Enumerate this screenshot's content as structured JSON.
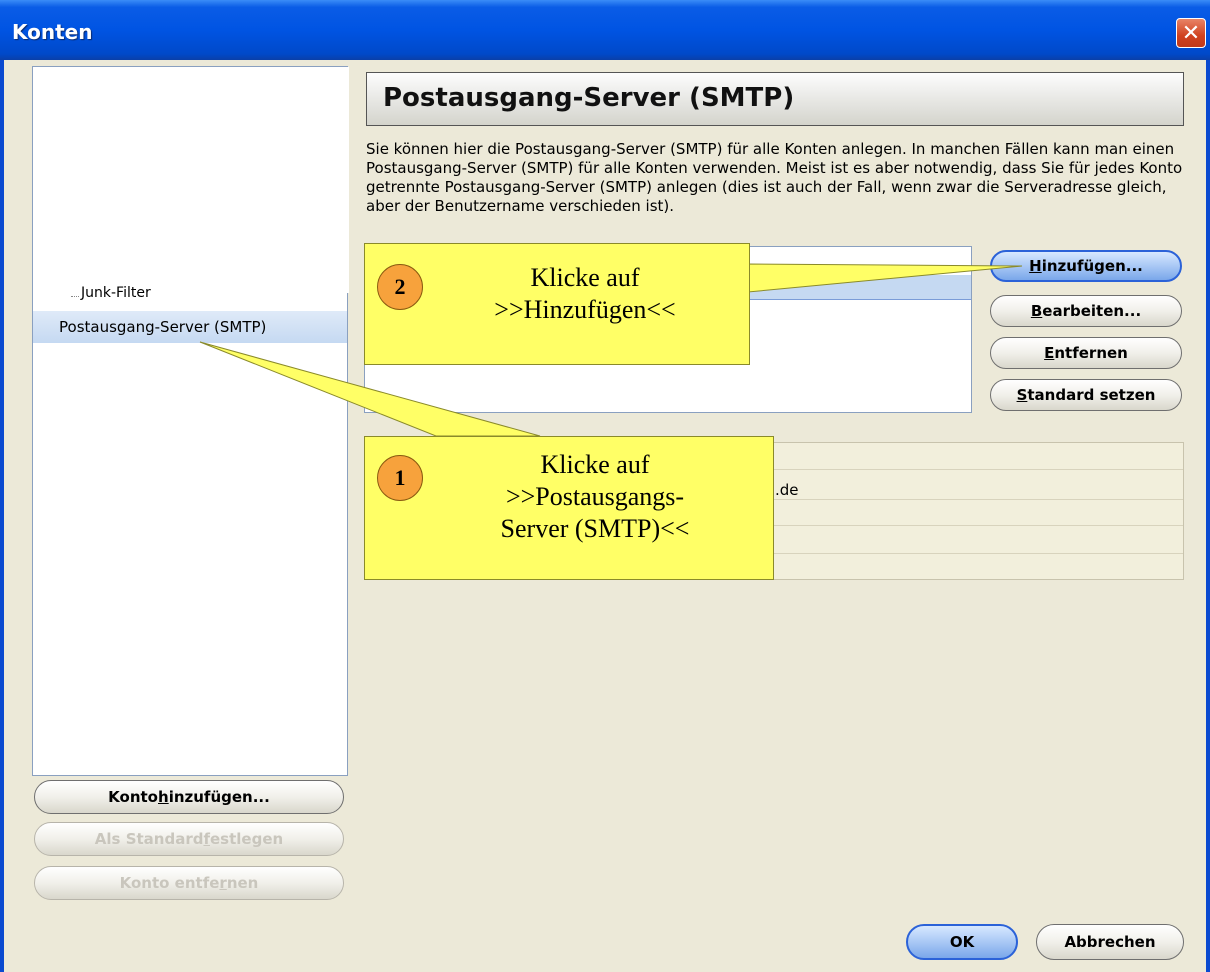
{
  "window": {
    "title": "Konten",
    "close_label": "✕"
  },
  "tree": {
    "items": [
      {
        "label": "Junk-Filter"
      },
      {
        "label": "Postausgang-Server (SMTP)"
      }
    ]
  },
  "main": {
    "heading": "Postausgang-Server (SMTP)",
    "description": "Sie können hier die Postausgang-Server (SMTP) für alle Konten anlegen. In manchen Fällen kann man einen Postausgang-Server (SMTP) für alle Konten verwenden. Meist ist es aber notwendig, dass Sie für jedes Konto getrennte Postausgang-Server (SMTP) anlegen (dies ist auch der Fall, wenn zwar die Serveradresse gleich, aber der Benutzername verschieden ist).",
    "details_value": ".de"
  },
  "buttons": {
    "add": {
      "pre": "",
      "mnemonic": "H",
      "post": "inzufügen..."
    },
    "edit": {
      "pre": "",
      "mnemonic": "B",
      "post": "earbeiten..."
    },
    "remove": {
      "pre": "",
      "mnemonic": "E",
      "post": "ntfernen"
    },
    "set_default": {
      "pre": "",
      "mnemonic": "S",
      "post": "tandard setzen"
    },
    "add_account": {
      "pre": "Konto ",
      "mnemonic": "h",
      "post": "inzufügen..."
    },
    "make_default": {
      "pre": "Als Standard ",
      "mnemonic": "f",
      "post": "estlegen"
    },
    "remove_account": {
      "pre": "Konto entfe",
      "mnemonic": "r",
      "post": "nen"
    },
    "ok": "OK",
    "cancel": "Abbrechen"
  },
  "callouts": [
    {
      "number": "1",
      "line1": "Klicke auf",
      "line2": ">>Postausgangs-",
      "line3": "Server (SMTP)<<"
    },
    {
      "number": "2",
      "line1": "Klicke auf",
      "line2": ">>Hinzufügen<<"
    }
  ],
  "colors": {
    "title_bar": "#0054e3",
    "callout_fill": "#ffff66",
    "callout_number": "#f7a23c",
    "selection": "#c5d9f2"
  }
}
